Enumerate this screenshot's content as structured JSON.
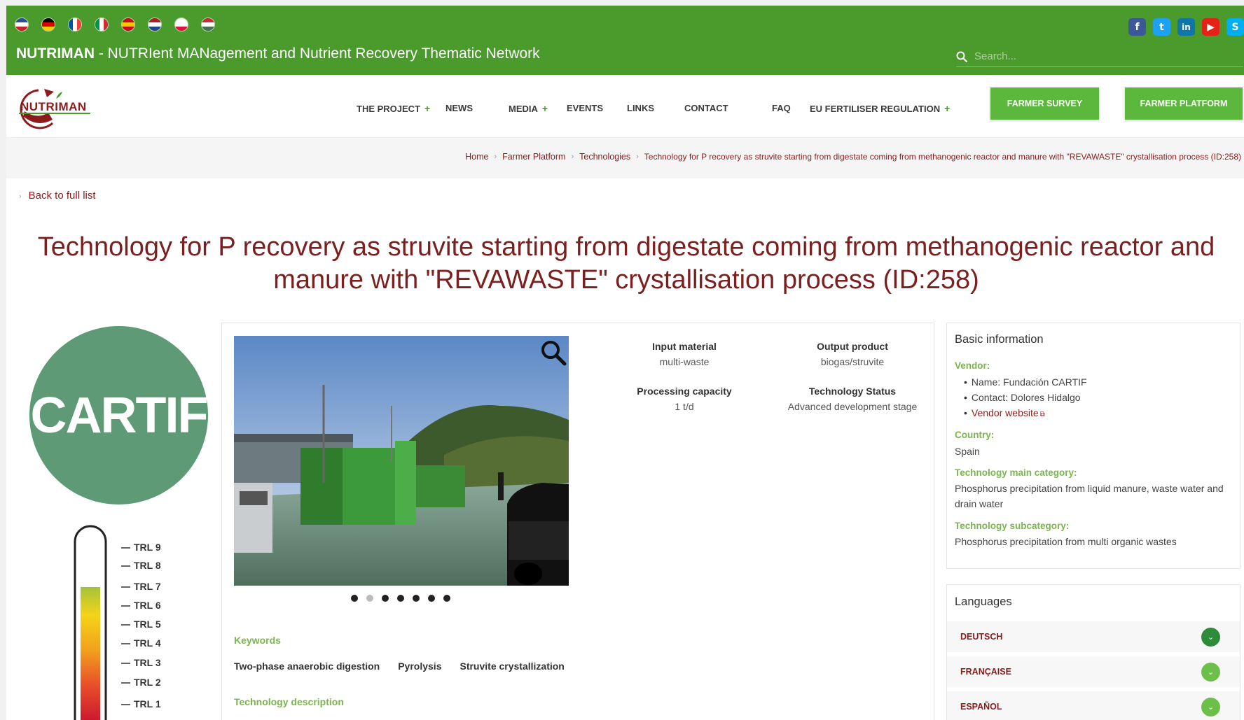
{
  "header": {
    "flags": [
      {
        "name": "uk-flag-icon",
        "colors": [
          "#2b4e9c",
          "#ffffff",
          "#c8202c"
        ]
      },
      {
        "name": "germany-flag-icon",
        "colors": [
          "#000000",
          "#dd0000",
          "#ffce00"
        ]
      },
      {
        "name": "france-flag-icon",
        "colors": [
          "#0055a4",
          "#ffffff",
          "#ef4135"
        ]
      },
      {
        "name": "italy-flag-icon",
        "colors": [
          "#009246",
          "#ffffff",
          "#ce2b37"
        ]
      },
      {
        "name": "spain-flag-icon",
        "colors": [
          "#c60b1e",
          "#ffc400",
          "#c60b1e"
        ]
      },
      {
        "name": "netherlands-flag-icon",
        "colors": [
          "#ae1c28",
          "#ffffff",
          "#21468b"
        ]
      },
      {
        "name": "poland-flag-icon",
        "colors": [
          "#ffffff",
          "#ffffff",
          "#dc143c"
        ]
      },
      {
        "name": "hungary-flag-icon",
        "colors": [
          "#ce2939",
          "#ffffff",
          "#477050"
        ]
      }
    ],
    "site_name": "NUTRIMAN",
    "site_subtitle": " - NUTRIent MANagement and Nutrient Recovery Thematic Network",
    "socials": [
      {
        "name": "facebook-icon",
        "glyph": "f",
        "color": "#3b5998"
      },
      {
        "name": "twitter-icon",
        "glyph": "t",
        "color": "#1da1f2"
      },
      {
        "name": "linkedin-icon",
        "glyph": "in",
        "color": "#0e76a8"
      },
      {
        "name": "youtube-icon",
        "glyph": "▶",
        "color": "#e62117"
      },
      {
        "name": "skype-icon",
        "glyph": "S",
        "color": "#00aff0"
      }
    ],
    "search_placeholder": "Search..."
  },
  "nav": {
    "logo_text": "NUTRIMAN",
    "items": [
      {
        "label": "THE PROJECT",
        "plus": "+"
      },
      {
        "label": "NEWS",
        "plus": ""
      },
      {
        "label": "MEDIA",
        "plus": "+"
      },
      {
        "label": "EVENTS",
        "plus": ""
      },
      {
        "label": "LINKS",
        "plus": ""
      },
      {
        "label": "CONTACT",
        "plus": ""
      },
      {
        "label": "FAQ",
        "plus": ""
      },
      {
        "label": "EU FERTILISER REGULATION",
        "plus": "+"
      }
    ],
    "farmer_survey": "FARMER SURVEY",
    "farmer_platform": "FARMER PLATFORM"
  },
  "breadcrumb": {
    "home": "Home",
    "farmer_platform": "Farmer Platform",
    "technologies": "Technologies",
    "current": "Technology for P recovery as struvite starting from digestate coming from methanogenic reactor and manure with \"REVAWASTE\" crystallisation process (ID:258)"
  },
  "back_link": "Back to full list",
  "title": "Technology for P recovery as struvite starting from digestate coming from methanogenic reactor and manure with \"REVAWASTE\" crystallisation process (ID:258)",
  "vendor_logo_text": "CARTIF",
  "trl": {
    "labels": [
      "TRL 9",
      "TRL 8",
      "TRL 7",
      "TRL 6",
      "TRL 5",
      "TRL 4",
      "TRL 3",
      "TRL 2",
      "TRL 1"
    ],
    "level": 7
  },
  "gallery": {
    "slide_count": 7,
    "active_index": 1
  },
  "properties": {
    "input_material_label": "Input material",
    "input_material": "multi-waste",
    "output_product_label": "Output product",
    "output_product": "biogas/struvite",
    "processing_capacity_label": "Processing capacity",
    "processing_capacity": "1 t/d",
    "technology_status_label": "Technology Status",
    "technology_status": "Advanced development stage"
  },
  "keywords": {
    "title": "Keywords",
    "items": [
      "Two-phase anaerobic digestion",
      "Pyrolysis",
      "Struvite crystallization"
    ]
  },
  "technology_description_title": "Technology description",
  "basic_info": {
    "title": "Basic information",
    "vendor_label": "Vendor:",
    "vendor_name": "Name: Fundación CARTIF",
    "vendor_contact": "Contact: Dolores Hidalgo",
    "vendor_website": "Vendor website",
    "country_label": "Country:",
    "country": "Spain",
    "main_category_label": "Technology main category:",
    "main_category": "Phosphorus precipitation from liquid manure, waste water and drain water",
    "subcategory_label": "Technology subcategory:",
    "subcategory": "Phosphorus precipitation from multi organic wastes"
  },
  "languages": {
    "title": "Languages",
    "items": [
      {
        "name": "DEUTSCH",
        "color": "#2e8b3a"
      },
      {
        "name": "FRANÇAISE",
        "color": "#6cc04a"
      },
      {
        "name": "ESPAÑOL",
        "color": "#6cc04a"
      }
    ]
  },
  "colors": {
    "brand_green": "#4a9a2c",
    "button_green": "#5cb83c",
    "title_maroon": "#7b1f1f",
    "label_green": "#7bb54e"
  }
}
